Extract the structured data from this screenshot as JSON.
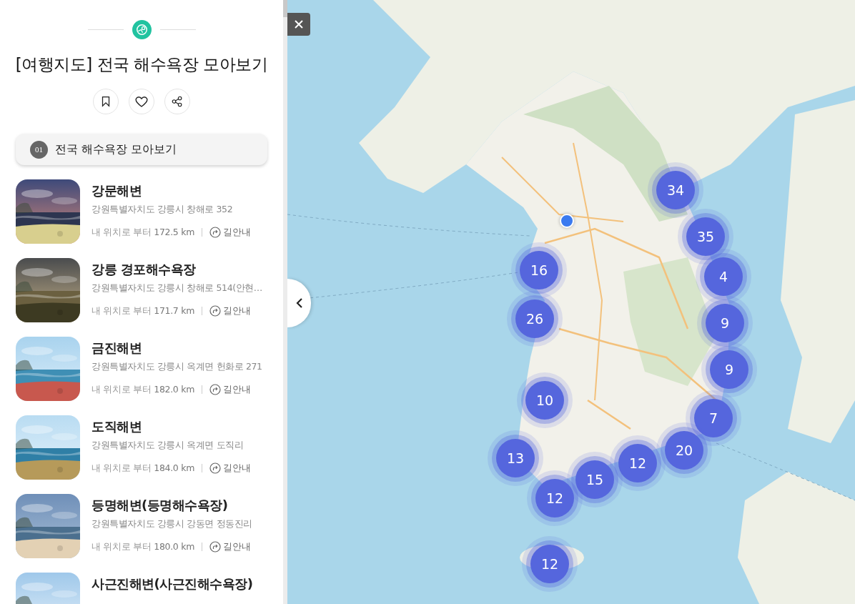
{
  "panel": {
    "title": "[여행지도] 전국 해수욕장 모아보기",
    "section": {
      "number": "01",
      "label": "전국 해수욕장 모아보기"
    },
    "places": [
      {
        "name": "강문해변",
        "address": "강원특별자치도 강릉시 창해로 352",
        "distance_prefix": "내 위치로 부터",
        "distance": "172.5 km",
        "directions": "길안내"
      },
      {
        "name": "강릉 경포해수욕장",
        "address": "강원특별자치도 강릉시 창해로 514(안현…",
        "distance_prefix": "내 위치로 부터",
        "distance": "171.7 km",
        "directions": "길안내"
      },
      {
        "name": "금진해변",
        "address": "강원특별자치도 강릉시 옥계면 헌화로 271",
        "distance_prefix": "내 위치로 부터",
        "distance": "182.0 km",
        "directions": "길안내"
      },
      {
        "name": "도직해변",
        "address": "강원특별자치도 강릉시 옥계면 도직리",
        "distance_prefix": "내 위치로 부터",
        "distance": "184.0 km",
        "directions": "길안내"
      },
      {
        "name": "등명해변(등명해수욕장)",
        "address": "강원특별자치도 강릉시 강동면 정동진리",
        "distance_prefix": "내 위치로 부터",
        "distance": "180.0 km",
        "directions": "길안내"
      },
      {
        "name": "사근진해변(사근진해수욕장)"
      }
    ]
  },
  "map": {
    "clusters": [
      "34",
      "35",
      "4",
      "9",
      "9",
      "16",
      "26",
      "10",
      "7",
      "20",
      "12",
      "13",
      "15",
      "12",
      "12"
    ]
  }
}
